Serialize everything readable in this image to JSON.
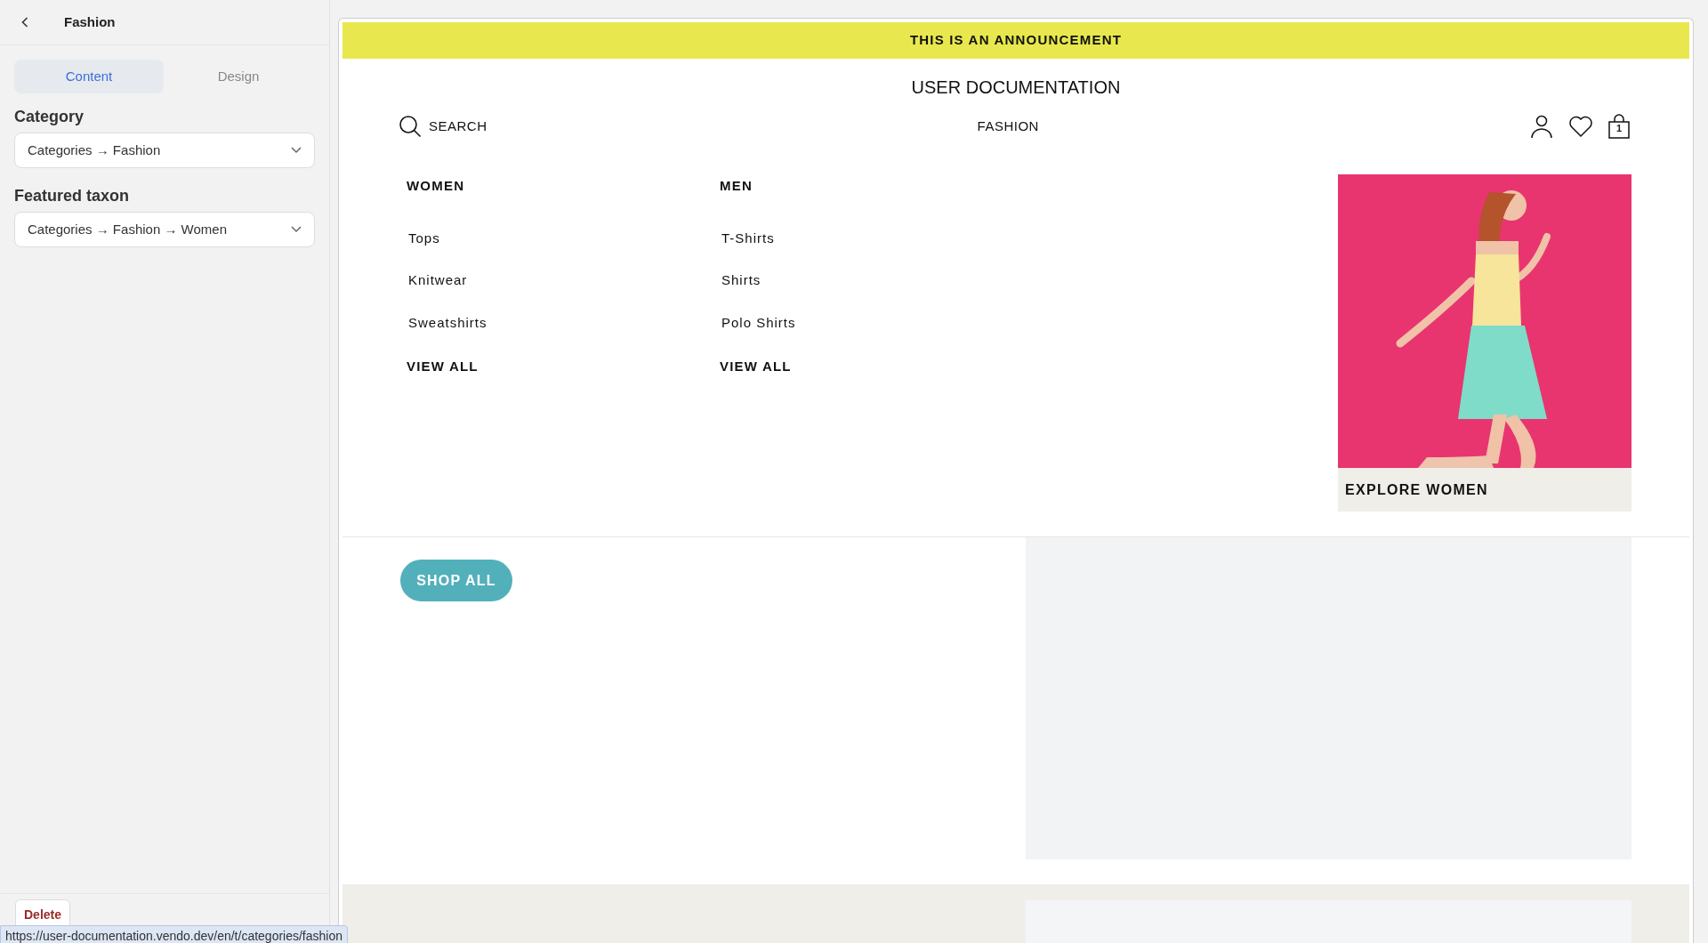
{
  "sidebar": {
    "title": "Fashion",
    "tabs": [
      {
        "label": "Content",
        "selected": true
      },
      {
        "label": "Design",
        "selected": false
      }
    ],
    "fields": [
      {
        "label": "Category",
        "value": "Categories → Fashion"
      },
      {
        "label": "Featured taxon",
        "value": "Categories → Fashion → Women"
      }
    ],
    "delete_button": "Delete"
  },
  "status_url": "https://user-documentation.vendo.dev/en/t/categories/fashion",
  "preview": {
    "announcement": "THIS IS AN ANNOUNCEMENT",
    "store_name": "USER DOCUMENTATION",
    "search": "SEARCH",
    "nav_link": "FASHION",
    "cart_count": "1",
    "menu_columns": [
      {
        "heading": "WOMEN",
        "links": [
          "Tops",
          "Knitwear",
          "Sweatshirts"
        ],
        "view_all": "VIEW ALL"
      },
      {
        "heading": "MEN",
        "links": [
          "T-Shirts",
          "Shirts",
          "Polo Shirts"
        ],
        "view_all": "VIEW ALL"
      }
    ],
    "promo": {
      "kind": "picture",
      "caption": "EXPLORE WOMEN"
    },
    "shop_button": "SHOP ALL"
  }
}
